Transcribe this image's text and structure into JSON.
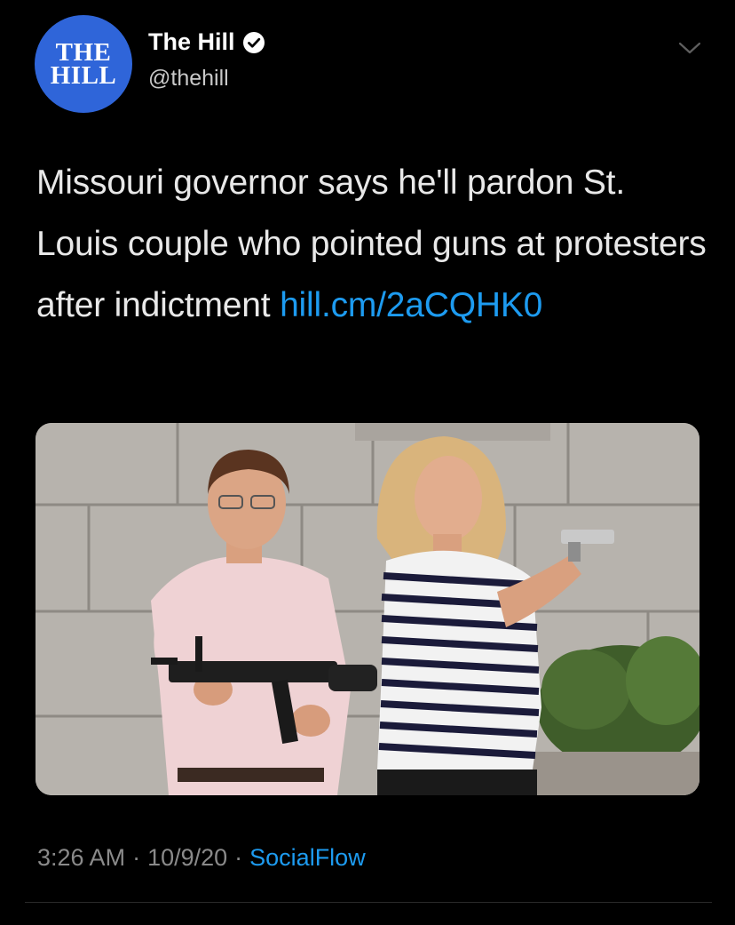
{
  "author": {
    "logo_line1": "THE",
    "logo_line2": "HILL",
    "display_name": "The Hill",
    "handle": "@thehill",
    "verified": true,
    "avatar_color": "#2f65d9"
  },
  "tweet": {
    "text_prefix": "Missouri governor says he'll pardon St. Louis couple who pointed guns at protesters after indictment ",
    "link_text": "hill.cm/2aCQHK0",
    "link_color": "#1d9bf0"
  },
  "meta": {
    "time": "3:26 AM",
    "date": "10/9/20",
    "separator": "·",
    "source": "SocialFlow"
  },
  "icons": {
    "menu": "chevron-down-icon",
    "verified": "verified-badge-icon"
  }
}
